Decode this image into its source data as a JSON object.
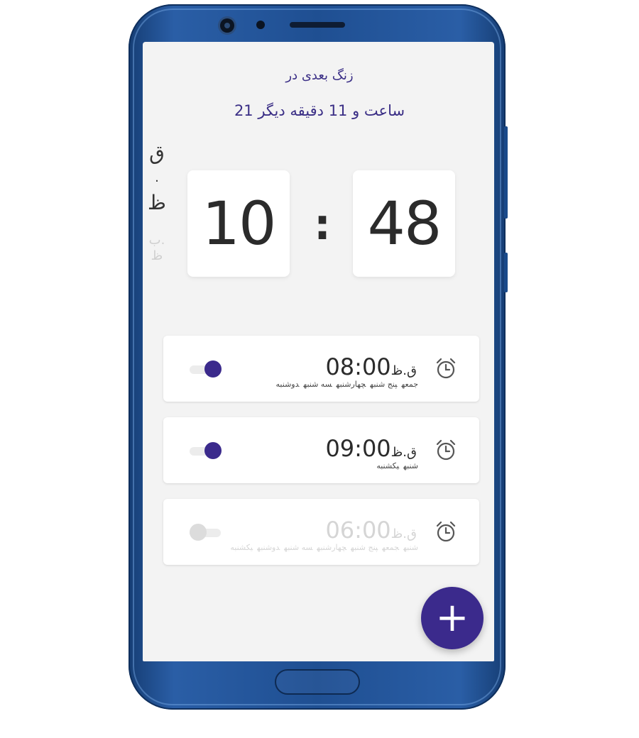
{
  "header": {
    "next_alarm_label": "زنگ بعدی در",
    "next_alarm_time": "21 ساعت و 11 دقیقه دیگر"
  },
  "clock": {
    "hour": "10",
    "minute": "48",
    "separator": ":",
    "period_active": "ق",
    "period_dot": ".",
    "period_active_2": "ظ",
    "period_inactive": "ب.",
    "period_inactive_2": "ظ"
  },
  "alarms": [
    {
      "time": "08:00",
      "period": "ق.ظ",
      "enabled": true,
      "days": [
        "جمعه",
        "پنج شنبه",
        "چهارشنبه",
        "سه شنبه",
        "دوشنبه"
      ],
      "icon": "alarm-clock-icon"
    },
    {
      "time": "09:00",
      "period": "ق.ظ",
      "enabled": true,
      "days": [
        "شنبه",
        "یکشنبه"
      ],
      "icon": "alarm-clock-icon"
    },
    {
      "time": "06:00",
      "period": "ق.ظ",
      "enabled": false,
      "days": [
        "شنبه",
        "جمعه",
        "پنج شنبه",
        "چهارشنبه",
        "سه شنبه",
        "دوشنبه",
        "یکشنبه"
      ],
      "icon": "alarm-clock-icon"
    }
  ],
  "fab": {
    "label": "+",
    "icon": "plus-icon"
  },
  "colors": {
    "accent": "#3b2a8c",
    "title_text": "#3b2f86",
    "screen_bg": "#f3f3f3",
    "phone_body": "#1f4f92"
  }
}
